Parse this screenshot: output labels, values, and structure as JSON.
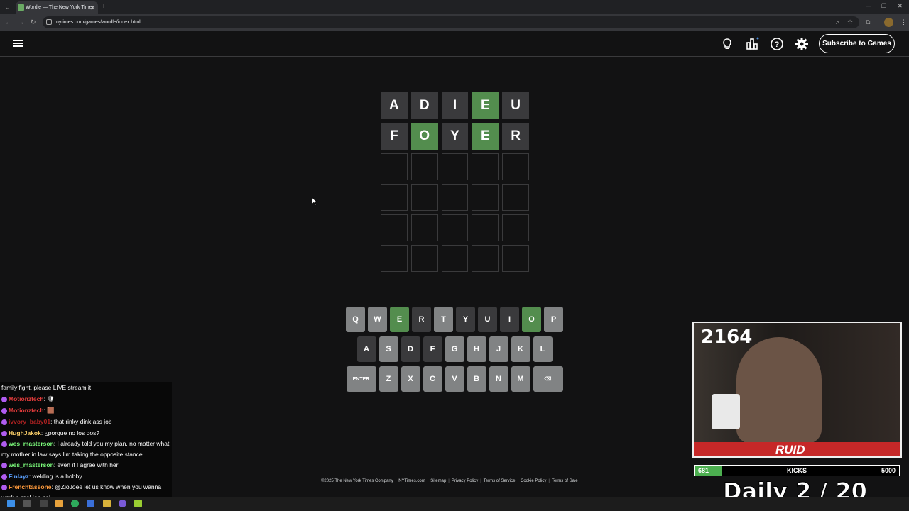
{
  "browser": {
    "tab_title": "Wordle — The New York Times",
    "tab_close": "✕",
    "new_tab": "+",
    "url": "nytimes.com/games/wordle/index.html"
  },
  "header": {
    "subscribe_label": "Subscribe to Games"
  },
  "board": [
    [
      {
        "letter": "A",
        "state": "absent"
      },
      {
        "letter": "D",
        "state": "absent"
      },
      {
        "letter": "I",
        "state": "absent"
      },
      {
        "letter": "E",
        "state": "correct"
      },
      {
        "letter": "U",
        "state": "absent"
      }
    ],
    [
      {
        "letter": "F",
        "state": "absent"
      },
      {
        "letter": "O",
        "state": "correct"
      },
      {
        "letter": "Y",
        "state": "absent"
      },
      {
        "letter": "E",
        "state": "correct"
      },
      {
        "letter": "R",
        "state": "absent"
      }
    ],
    [
      {
        "letter": "",
        "state": "empty"
      },
      {
        "letter": "",
        "state": "empty"
      },
      {
        "letter": "",
        "state": "empty"
      },
      {
        "letter": "",
        "state": "empty"
      },
      {
        "letter": "",
        "state": "empty"
      }
    ],
    [
      {
        "letter": "",
        "state": "empty"
      },
      {
        "letter": "",
        "state": "empty"
      },
      {
        "letter": "",
        "state": "empty"
      },
      {
        "letter": "",
        "state": "empty"
      },
      {
        "letter": "",
        "state": "empty"
      }
    ],
    [
      {
        "letter": "",
        "state": "empty"
      },
      {
        "letter": "",
        "state": "empty"
      },
      {
        "letter": "",
        "state": "empty"
      },
      {
        "letter": "",
        "state": "empty"
      },
      {
        "letter": "",
        "state": "empty"
      }
    ],
    [
      {
        "letter": "",
        "state": "empty"
      },
      {
        "letter": "",
        "state": "empty"
      },
      {
        "letter": "",
        "state": "empty"
      },
      {
        "letter": "",
        "state": "empty"
      },
      {
        "letter": "",
        "state": "empty"
      }
    ]
  ],
  "keyboard": [
    [
      {
        "k": "Q",
        "s": "unused"
      },
      {
        "k": "W",
        "s": "unused"
      },
      {
        "k": "E",
        "s": "correct"
      },
      {
        "k": "R",
        "s": "absent"
      },
      {
        "k": "T",
        "s": "unused"
      },
      {
        "k": "Y",
        "s": "absent"
      },
      {
        "k": "U",
        "s": "absent"
      },
      {
        "k": "I",
        "s": "absent"
      },
      {
        "k": "O",
        "s": "correct"
      },
      {
        "k": "P",
        "s": "unused"
      }
    ],
    [
      {
        "k": "A",
        "s": "absent"
      },
      {
        "k": "S",
        "s": "unused"
      },
      {
        "k": "D",
        "s": "absent"
      },
      {
        "k": "F",
        "s": "absent"
      },
      {
        "k": "G",
        "s": "unused"
      },
      {
        "k": "H",
        "s": "unused"
      },
      {
        "k": "J",
        "s": "unused"
      },
      {
        "k": "K",
        "s": "unused"
      },
      {
        "k": "L",
        "s": "unused"
      }
    ],
    [
      {
        "k": "ENTER",
        "s": "unused",
        "wide": true
      },
      {
        "k": "Z",
        "s": "unused"
      },
      {
        "k": "X",
        "s": "unused"
      },
      {
        "k": "C",
        "s": "unused"
      },
      {
        "k": "V",
        "s": "unused"
      },
      {
        "k": "B",
        "s": "unused"
      },
      {
        "k": "N",
        "s": "unused"
      },
      {
        "k": "M",
        "s": "unused"
      },
      {
        "k": "⌫",
        "s": "unused",
        "wide": true,
        "name": "backspace"
      }
    ]
  ],
  "footer": [
    "©2025 The New York Times Company",
    "NYTimes.com",
    "Sitemap",
    "Privacy Policy",
    "Terms of Service",
    "Cookie Policy",
    "Terms of Sale"
  ],
  "chat": [
    {
      "user": "",
      "text": "family fight. please LIVE stream it",
      "color": "#ffffff"
    },
    {
      "user": "Motionztech",
      "text": ": 🛡",
      "color": "#e23b3b"
    },
    {
      "user": "Motionztech",
      "text": ": 🟫",
      "color": "#e23b3b"
    },
    {
      "user": "ivvory_baby01",
      "text": ": that rinky dink ass job",
      "color": "#b22222"
    },
    {
      "user": "HughJakok",
      "text": ": ¿porque no los dos?",
      "color": "#ffd36b"
    },
    {
      "user": "wes_masterson",
      "text": ": I already told you my plan. no matter what my mother in law says I'm taking the opposite stance",
      "color": "#7cfc7c"
    },
    {
      "user": "wes_masterson",
      "text": ": even if I agree with her",
      "color": "#7cfc7c"
    },
    {
      "user": "Finlayz",
      "text": ": welding is a hobby",
      "color": "#5aa0ff"
    },
    {
      "user": "Frenchtassone",
      "text": ": @ZioJoee let us know when you wanna work a real job pal",
      "color": "#ff9b3d"
    }
  ],
  "stream": {
    "count": "2164",
    "logo": "RUID",
    "goal_current": "681",
    "goal_label": "KICKS",
    "goal_max": "5000",
    "goal_fraction": 0.136,
    "daily": "Daily  2 / 20"
  },
  "colors": {
    "correct": "#538d4e",
    "absent": "#3a3a3c",
    "unused_key": "#818384",
    "background": "#121213"
  }
}
